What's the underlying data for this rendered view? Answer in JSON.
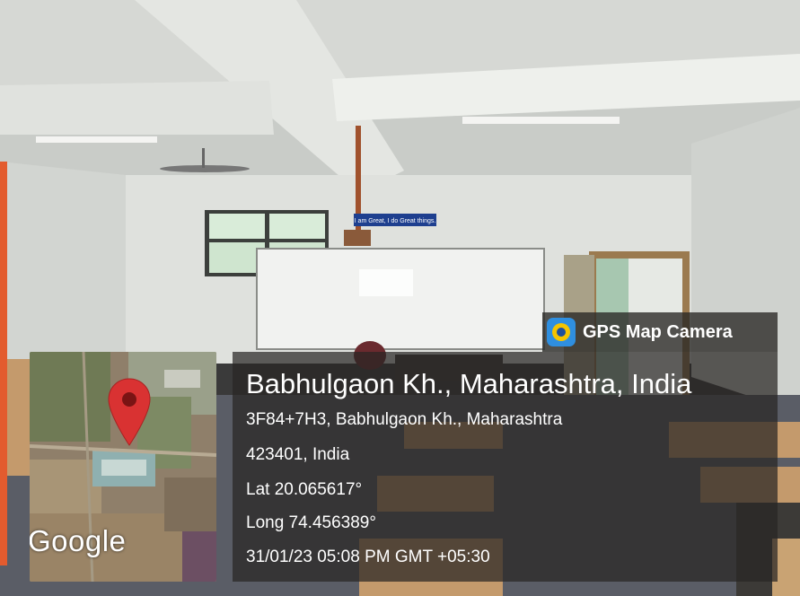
{
  "stamp": {
    "app_name": "GPS Map Camera",
    "title": "Babhulgaon Kh., Maharashtra, India",
    "address_line1": "3F84+7H3, Babhulgaon Kh., Maharashtra",
    "address_line2": "423401, India",
    "latitude": "Lat 20.065617°",
    "longitude": "Long 74.456389°",
    "datetime": "31/01/23 05:08 PM GMT +05:30"
  },
  "map": {
    "brand": "Google",
    "pin_color": "#d93232"
  },
  "scene": {
    "sign_text": "I am Great, I do Great things."
  },
  "colors": {
    "overlay": "#28261f",
    "text": "#ffffff",
    "app_icon_blue": "#2f8fe0",
    "app_icon_yellow": "#f5c400"
  }
}
